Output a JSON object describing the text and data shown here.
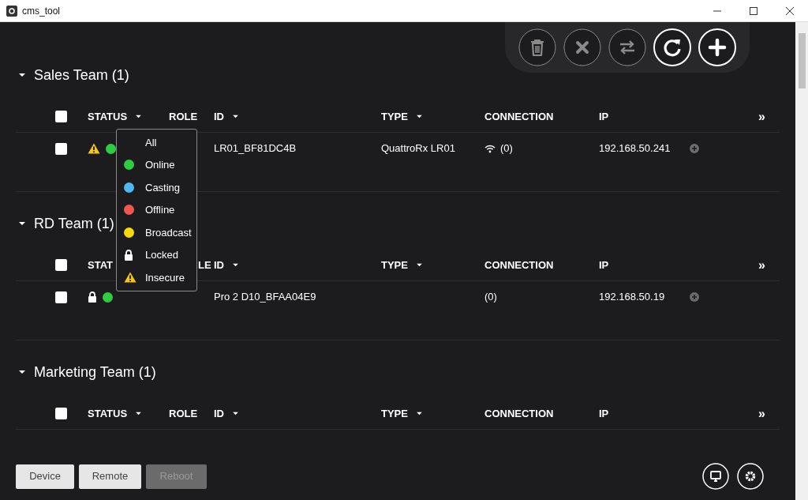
{
  "window": {
    "title": "cms_tool"
  },
  "toolbar": [
    {
      "kind": "trash",
      "disabled": true
    },
    {
      "kind": "close",
      "disabled": true
    },
    {
      "kind": "swap",
      "disabled": true
    },
    {
      "kind": "refresh",
      "disabled": false
    },
    {
      "kind": "add",
      "disabled": false
    }
  ],
  "groups": [
    {
      "title": "Sales Team (1)",
      "expanded": true,
      "columns": [
        {
          "label": "STATUS",
          "sortable": true
        },
        {
          "label": "ROLE",
          "sortable": false
        },
        {
          "label": "ID",
          "sortable": true
        },
        {
          "label": "TYPE",
          "sortable": true
        },
        {
          "label": "CONNECTION",
          "sortable": false
        },
        {
          "label": "IP",
          "sortable": false
        }
      ],
      "more": "»",
      "all_checked": false,
      "rows": [
        {
          "checked": false,
          "status": [
            {
              "kind": "insecure"
            },
            {
              "kind": "online"
            }
          ],
          "id": "LR01_BF81DC4B",
          "type": "QuattroRx LR01",
          "wifi": true,
          "connection": "(0)",
          "ip": "192.168.50.241"
        }
      ]
    },
    {
      "title": "RD Team (1)",
      "expanded": true,
      "columns": [
        {
          "label": "STAT",
          "sortable": false
        },
        {
          "label": "LE",
          "sortable": false
        },
        {
          "label": "ID",
          "sortable": true
        },
        {
          "label": "TYPE",
          "sortable": true
        },
        {
          "label": "CONNECTION",
          "sortable": false
        },
        {
          "label": "IP",
          "sortable": false
        }
      ],
      "more": "»",
      "all_checked": false,
      "rows": [
        {
          "checked": false,
          "status": [
            {
              "kind": "locked"
            },
            {
              "kind": "online"
            }
          ],
          "id": "Pro 2 D10_BFAA04E9",
          "wifi": false,
          "connection": "(0)",
          "ip": "192.168.50.19"
        }
      ]
    },
    {
      "title": "Marketing Team (1)",
      "expanded": true,
      "columns": [
        {
          "label": "STATUS",
          "sortable": true
        },
        {
          "label": "ROLE",
          "sortable": false
        },
        {
          "label": "ID",
          "sortable": true
        },
        {
          "label": "TYPE",
          "sortable": true
        },
        {
          "label": "CONNECTION",
          "sortable": false
        },
        {
          "label": "IP",
          "sortable": false
        }
      ],
      "more": "»",
      "all_checked": false
    }
  ],
  "status_filter_menu": [
    {
      "label": "All",
      "kind": "none"
    },
    {
      "label": "Online",
      "kind": "dot",
      "color": "#2ecc40"
    },
    {
      "label": "Casting",
      "kind": "dot",
      "color": "#4fb8f0"
    },
    {
      "label": "Offline",
      "kind": "dot",
      "color": "#f0574f"
    },
    {
      "label": "Broadcast",
      "kind": "dot",
      "color": "#f5d90a"
    },
    {
      "label": "Locked",
      "kind": "lock"
    },
    {
      "label": "Insecure",
      "kind": "warning"
    }
  ],
  "bottom_buttons": [
    {
      "label": "Device",
      "disabled": false
    },
    {
      "label": "Remote",
      "disabled": false
    },
    {
      "label": "Reboot",
      "disabled": true
    }
  ]
}
